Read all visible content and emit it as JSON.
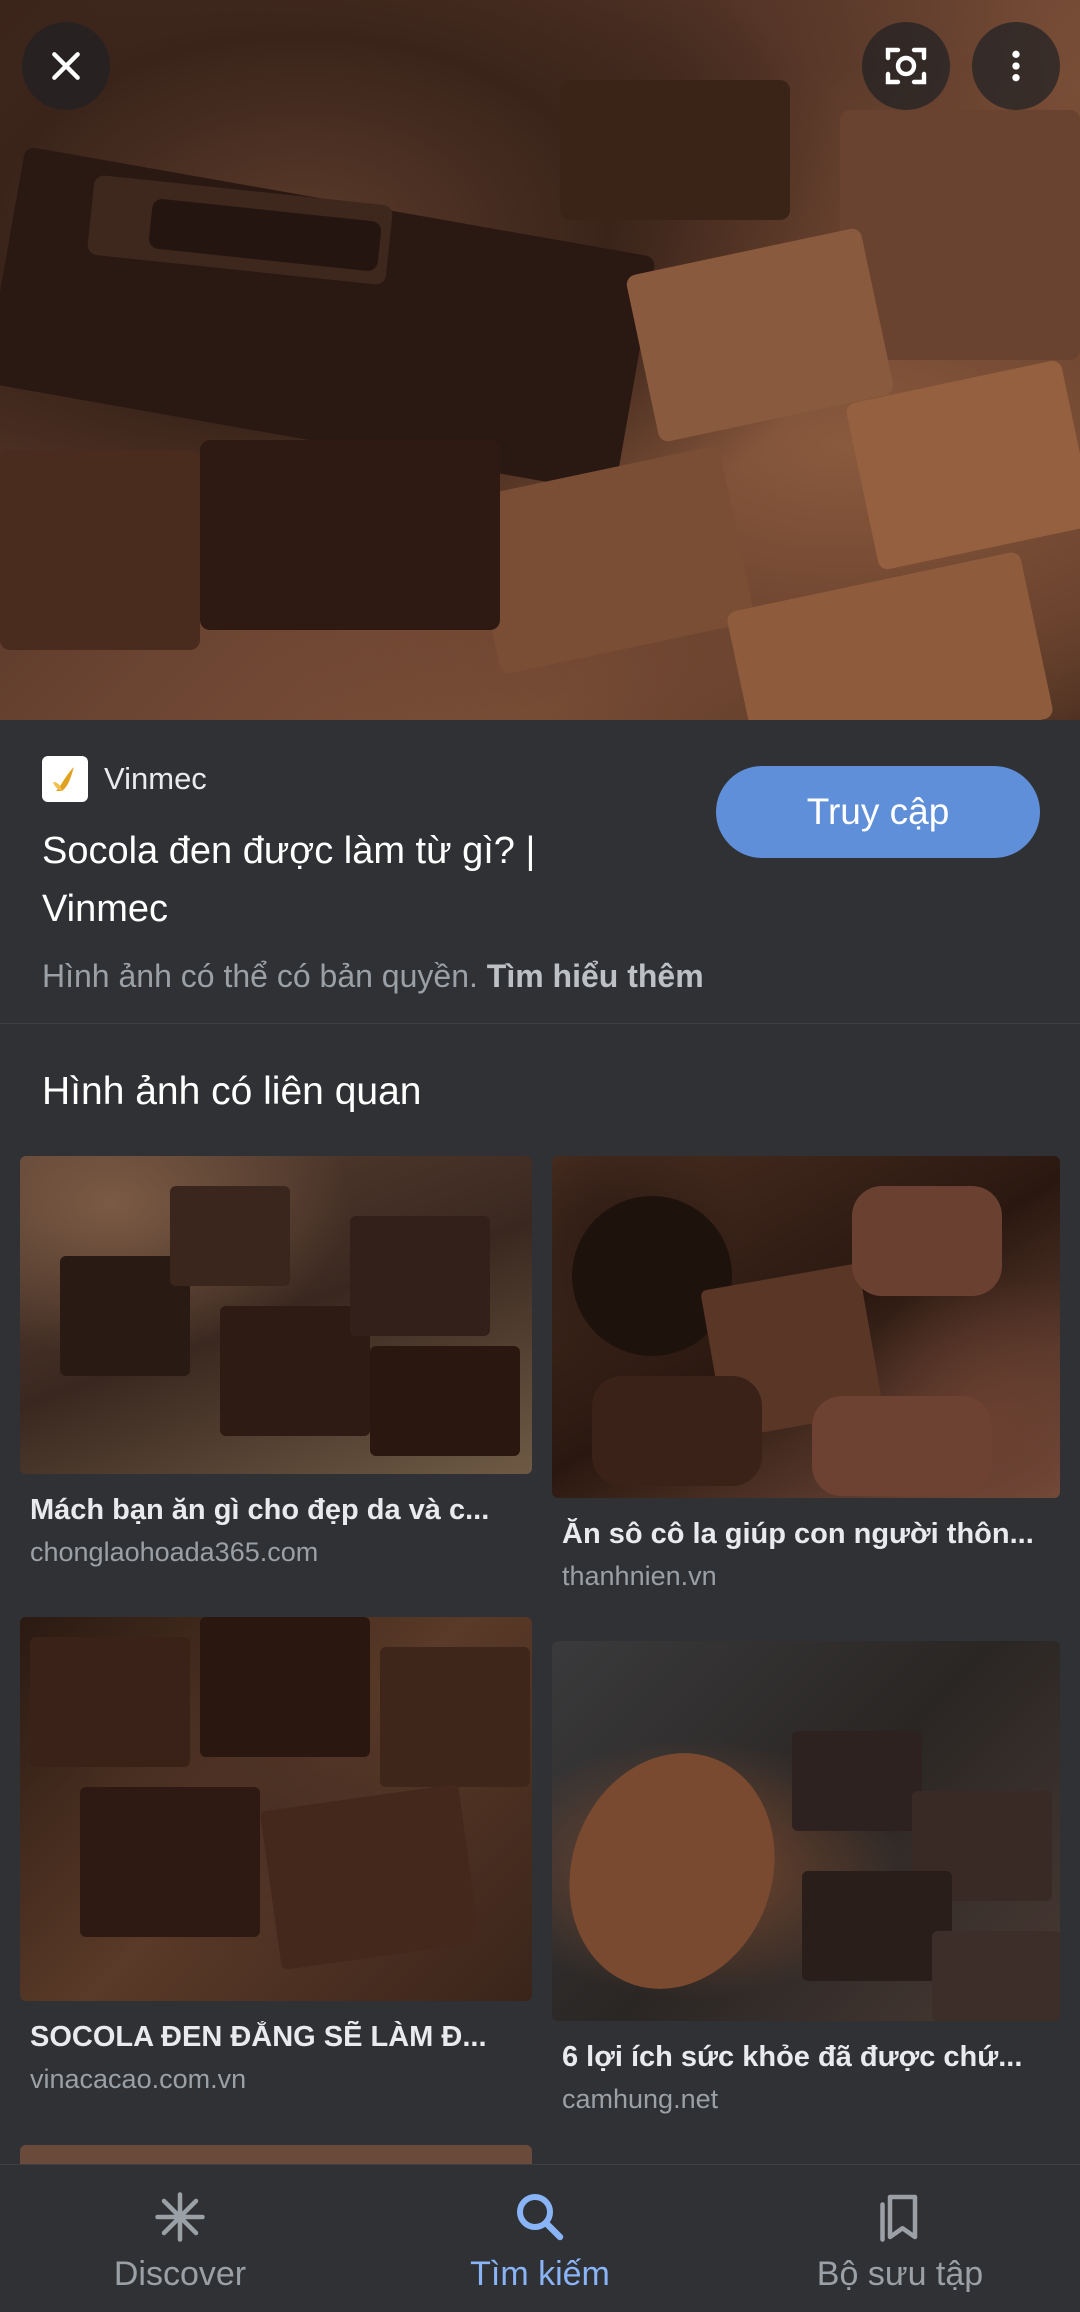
{
  "hero": {
    "close_icon": "close-icon",
    "lens_icon": "lens-icon",
    "more_icon": "more-vert-icon"
  },
  "source": {
    "site_name": "Vinmec",
    "title": "Socola đen được làm từ gì? | Vinmec",
    "visit_label": "Truy cập",
    "copyright_text": "Hình ảnh có thể có bản quyền.",
    "learn_more": "Tìm hiểu thêm"
  },
  "related": {
    "heading": "Hình ảnh có liên quan",
    "items": [
      {
        "title": "Mách bạn ăn gì cho đẹp da và c...",
        "domain": "chonglaohoada365.com"
      },
      {
        "title": "Ăn sô cô la giúp con người thôn...",
        "domain": "thanhnien.vn"
      },
      {
        "title": "SOCOLA ĐEN ĐẮNG SẼ LÀM Đ...",
        "domain": "vinacacao.com.vn"
      },
      {
        "title": "6 lợi ích sức khỏe đã được chứ...",
        "domain": "camhung.net"
      }
    ]
  },
  "nav": {
    "items": [
      {
        "label": "Discover",
        "icon": "asterisk-icon",
        "active": false
      },
      {
        "label": "Tìm kiếm",
        "icon": "search-icon",
        "active": true
      },
      {
        "label": "Bộ sưu tập",
        "icon": "collections-icon",
        "active": false
      }
    ]
  },
  "colors": {
    "background": "#303134",
    "accent": "#8ab4f8",
    "button": "#5f8fd9",
    "muted_text": "#9aa0a6"
  }
}
